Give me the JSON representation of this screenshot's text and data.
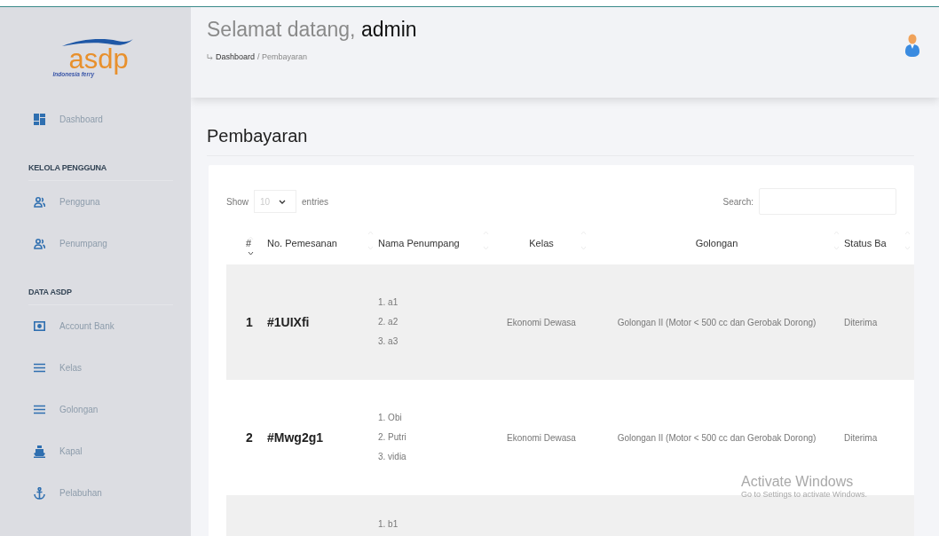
{
  "sidebar": {
    "logo": {
      "wordmark": "asdp",
      "tagline": "Indonesia ferry"
    },
    "items": [
      {
        "kind": "link",
        "label": "Dashboard"
      },
      {
        "kind": "heading",
        "label": "KELOLA PENGGUNA"
      },
      {
        "kind": "link",
        "label": "Pengguna"
      },
      {
        "kind": "link",
        "label": "Penumpang"
      },
      {
        "kind": "heading",
        "label": "DATA ASDP"
      },
      {
        "kind": "link",
        "label": "Account Bank"
      },
      {
        "kind": "link",
        "label": "Kelas"
      },
      {
        "kind": "link",
        "label": "Golongan"
      },
      {
        "kind": "link",
        "label": "Kapal"
      },
      {
        "kind": "link",
        "label": "Pelabuhan"
      }
    ]
  },
  "header": {
    "greeting": "Selamat datang, **admin**",
    "breadcrumb": [
      {
        "label": "Dashboard",
        "kind": "link"
      },
      {
        "label": "/ Pembayaran",
        "kind": "current"
      }
    ]
  },
  "page_title": "Pembayaran",
  "table_controls": {
    "show_label": "Show",
    "page_size": "10",
    "entries_label": "entries",
    "search_label": "Search:"
  },
  "table": {
    "columns": [
      {
        "label": "#",
        "sorted": true
      },
      {
        "label": "No. Pemesanan",
        "sorted": false
      },
      {
        "label": "Nama Penumpang",
        "sorted": false
      },
      {
        "label": "Kelas",
        "sorted": false
      },
      {
        "label": "Golongan",
        "sorted": false
      },
      {
        "label": "Status Ba",
        "sorted": false
      }
    ],
    "rows": [
      {
        "number": "1",
        "booking": "#1UIXfi",
        "passengers": [
          "1. a1",
          "2. a2",
          "3. a3"
        ],
        "class": "Ekonomi Dewasa",
        "category": "Golongan II (Motor < 500 cc dan Gerobak Dorong)",
        "status": "Diterima"
      },
      {
        "number": "2",
        "booking": "#Mwg2g1",
        "passengers": [
          "1. Obi",
          "2. Putri",
          "3. vidia"
        ],
        "class": "Ekonomi Dewasa",
        "category": "Golongan II (Motor < 500 cc dan Gerobak Dorong)",
        "status": "Diterima"
      },
      {
        "passengers": [
          "1. b1"
        ]
      }
    ]
  },
  "os_notice": {
    "title": "Activate Windows",
    "subtitle": "Go to Settings to activate Windows."
  }
}
